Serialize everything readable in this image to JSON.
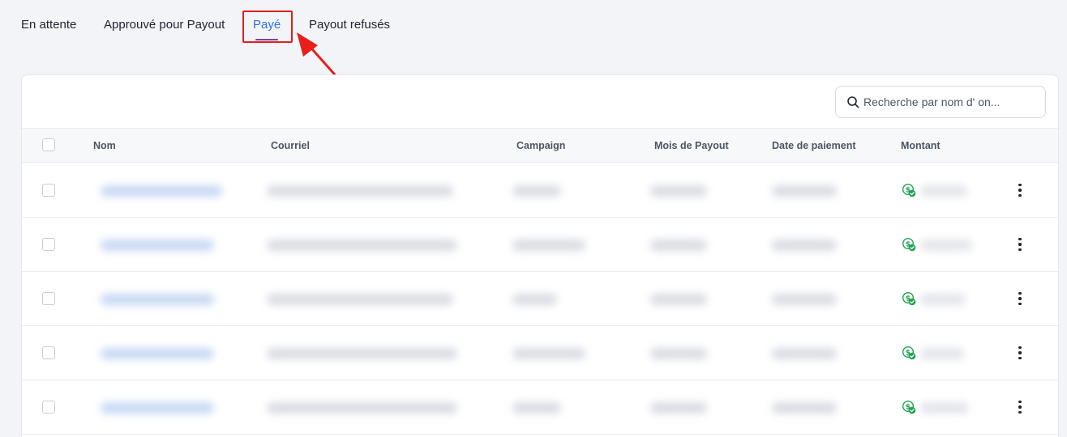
{
  "tabs": [
    {
      "label": "En attente",
      "active": false
    },
    {
      "label": "Approuvé pour Payout",
      "active": false
    },
    {
      "label": "Payé",
      "active": true
    },
    {
      "label": "Payout refusés",
      "active": false
    }
  ],
  "search": {
    "placeholder": "Recherche par nom d' on..."
  },
  "table": {
    "headers": [
      "Nom",
      "Courriel",
      "Campaign",
      "Mois de Payout",
      "Date de paiement",
      "Montant"
    ]
  },
  "colors": {
    "accent": "#2f6fe0",
    "tab_underline": "#7b3fa8",
    "highlight_box": "#e0201c",
    "paid_icon": "#1fa351"
  },
  "icons": {
    "search": "search-icon",
    "amount": "dollar-check-icon",
    "row_menu": "more-vertical-icon"
  }
}
